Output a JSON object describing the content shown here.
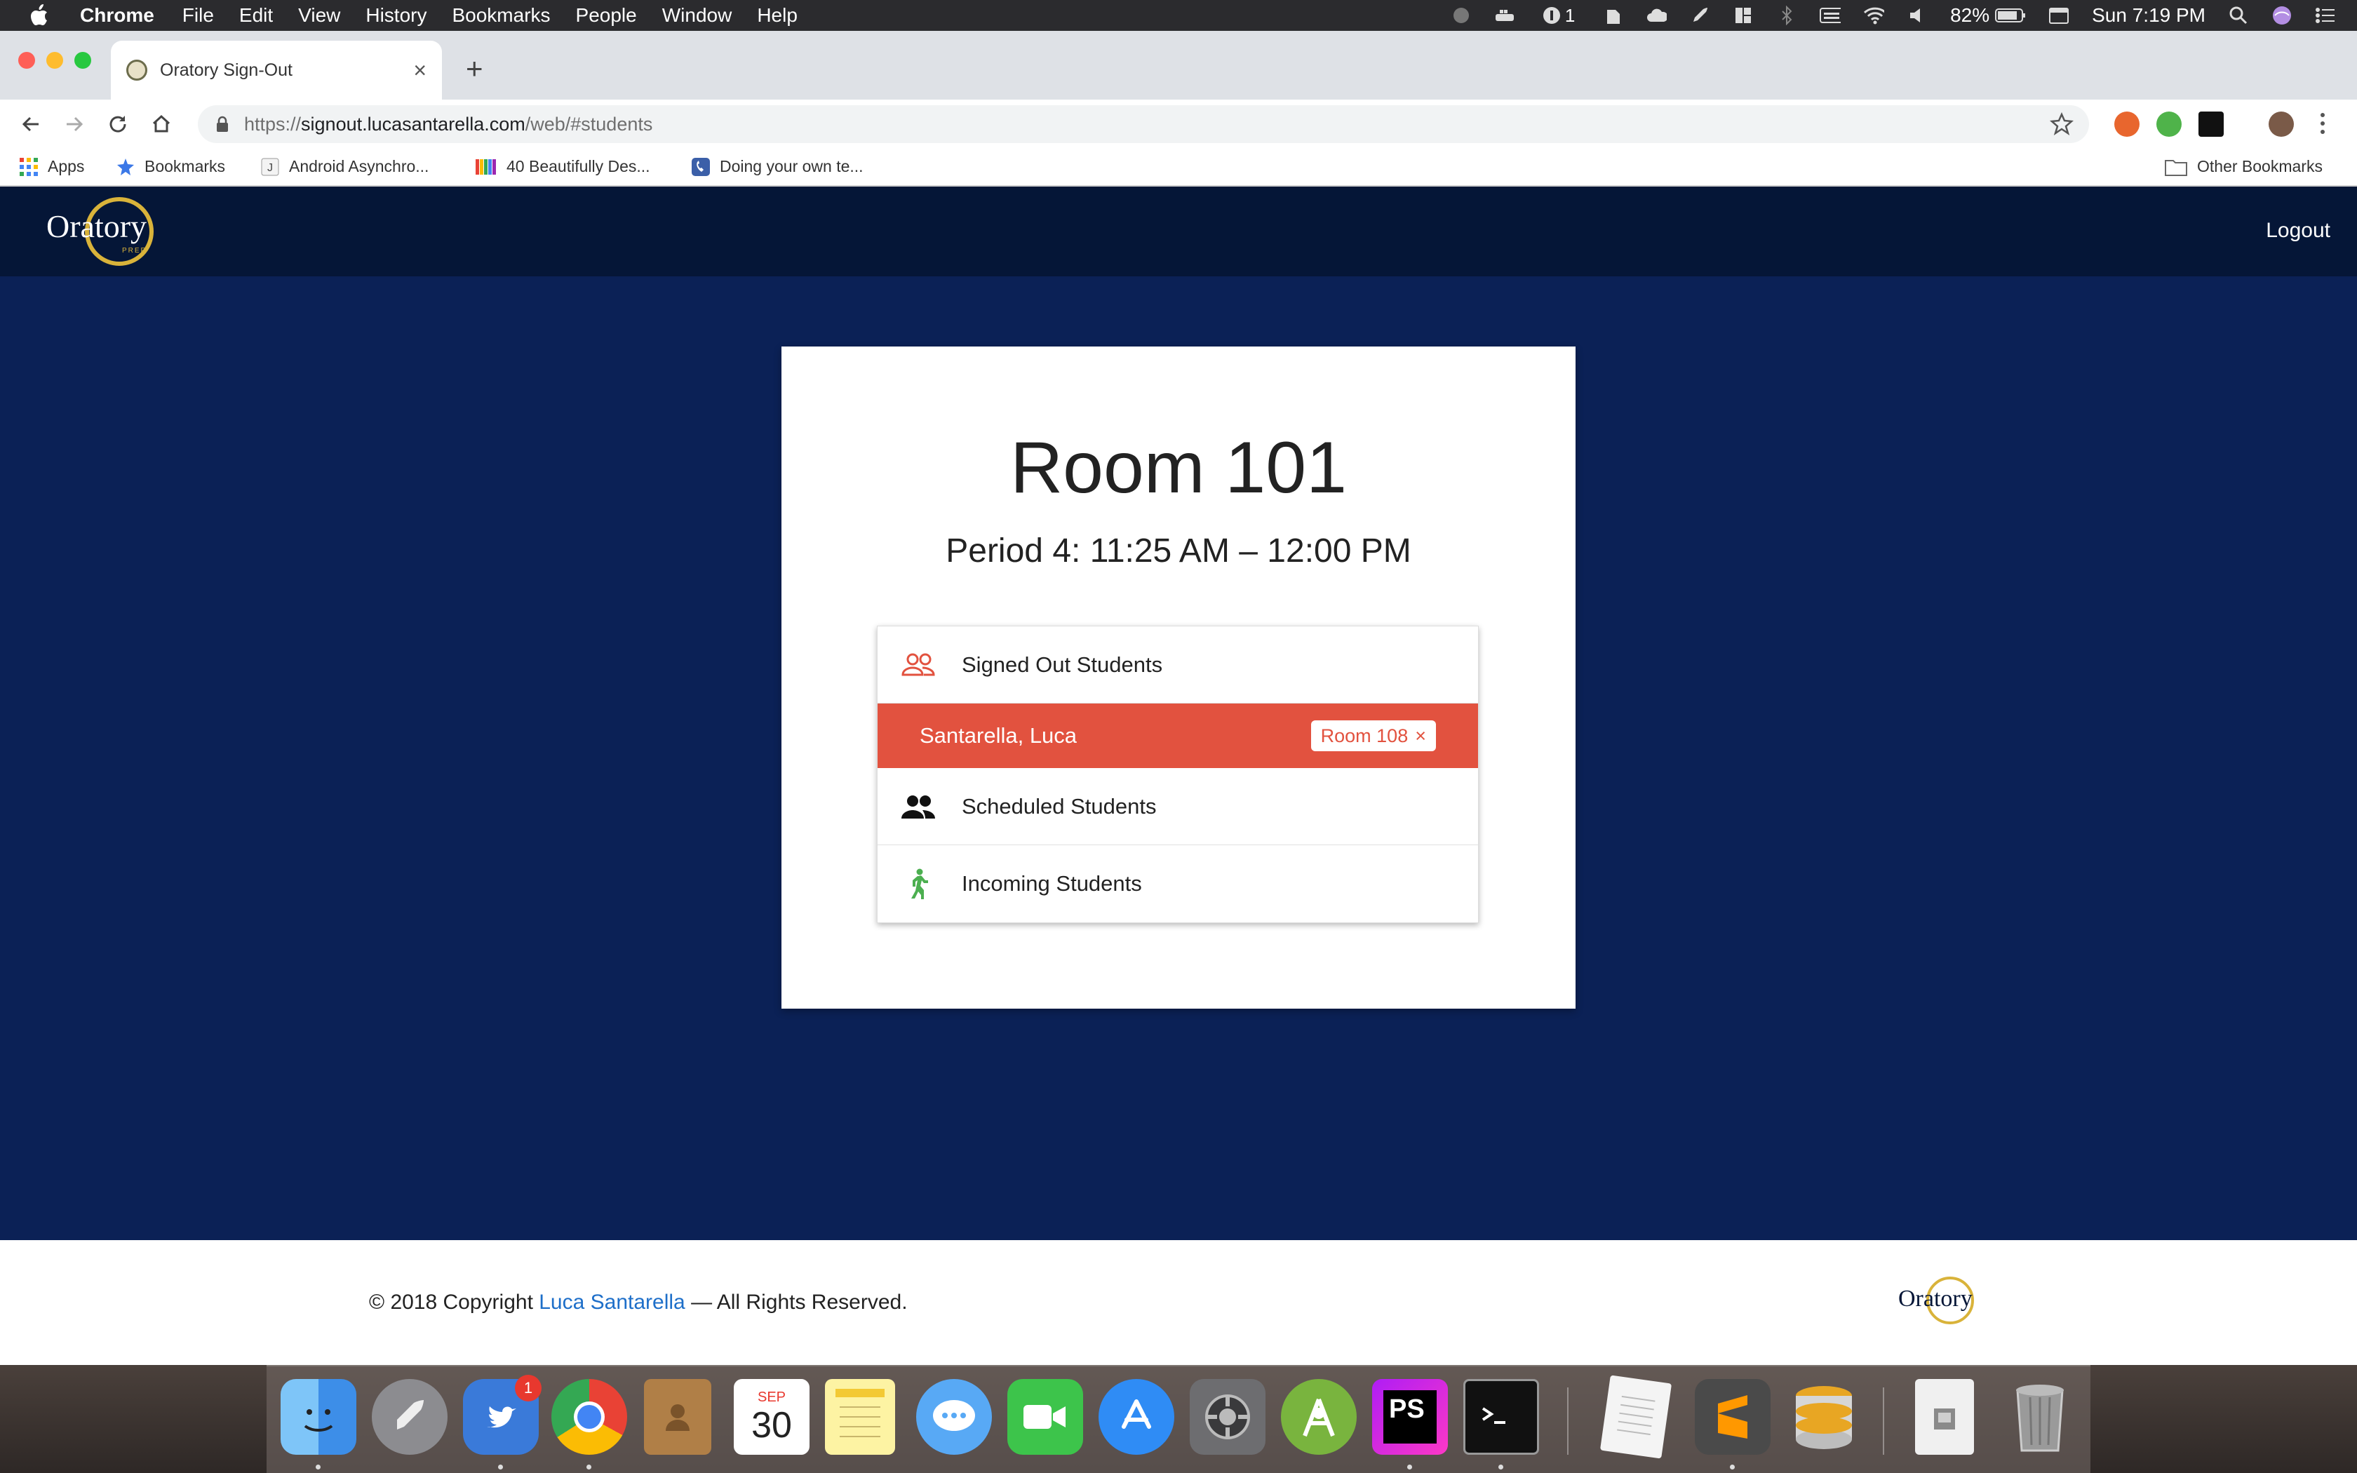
{
  "menubar": {
    "app_name": "Chrome",
    "items": [
      "File",
      "Edit",
      "View",
      "History",
      "Bookmarks",
      "People",
      "Window",
      "Help"
    ],
    "onepassword_count": "1",
    "battery": "82%",
    "clock": "Sun 7:19 PM"
  },
  "browser": {
    "tab_title": "Oratory Sign-Out",
    "url_prefix": "https://",
    "url_host": "signout.lucasantarella.com",
    "url_path": "/web/#students",
    "bookmarks": [
      {
        "label": "Apps"
      },
      {
        "label": "Bookmarks"
      },
      {
        "label": "Android Asynchro..."
      },
      {
        "label": "40 Beautifully Des..."
      },
      {
        "label": "Doing your own te..."
      }
    ],
    "other_bookmarks": "Other Bookmarks"
  },
  "site": {
    "logo_text": "Oratory",
    "logo_sub": "PREP",
    "logout_label": "Logout"
  },
  "room": {
    "title": "Room 101",
    "period": "Period 4: 11:25 AM – 12:00 PM"
  },
  "student_list": {
    "signed_out_label": "Signed Out Students",
    "student_name": "Santarella, Luca",
    "student_destination": "Room 108",
    "remove_glyph": "×",
    "scheduled_label": "Scheduled Students",
    "incoming_label": "Incoming Students"
  },
  "footer": {
    "copyright_prefix": "© 2018 Copyright",
    "author": "Luca Santarella",
    "copyright_suffix": "— All Rights Reserved."
  },
  "dock": {
    "calendar_month": "SEP",
    "calendar_day": "30",
    "notification_badge": "1",
    "phpstorm_label": "PS"
  },
  "colors": {
    "page_bg": "#0b2156",
    "header_bg": "#051637",
    "accent_red": "#e2523f",
    "link_blue": "#1e6fc9",
    "logo_gold": "#d9b33a"
  }
}
